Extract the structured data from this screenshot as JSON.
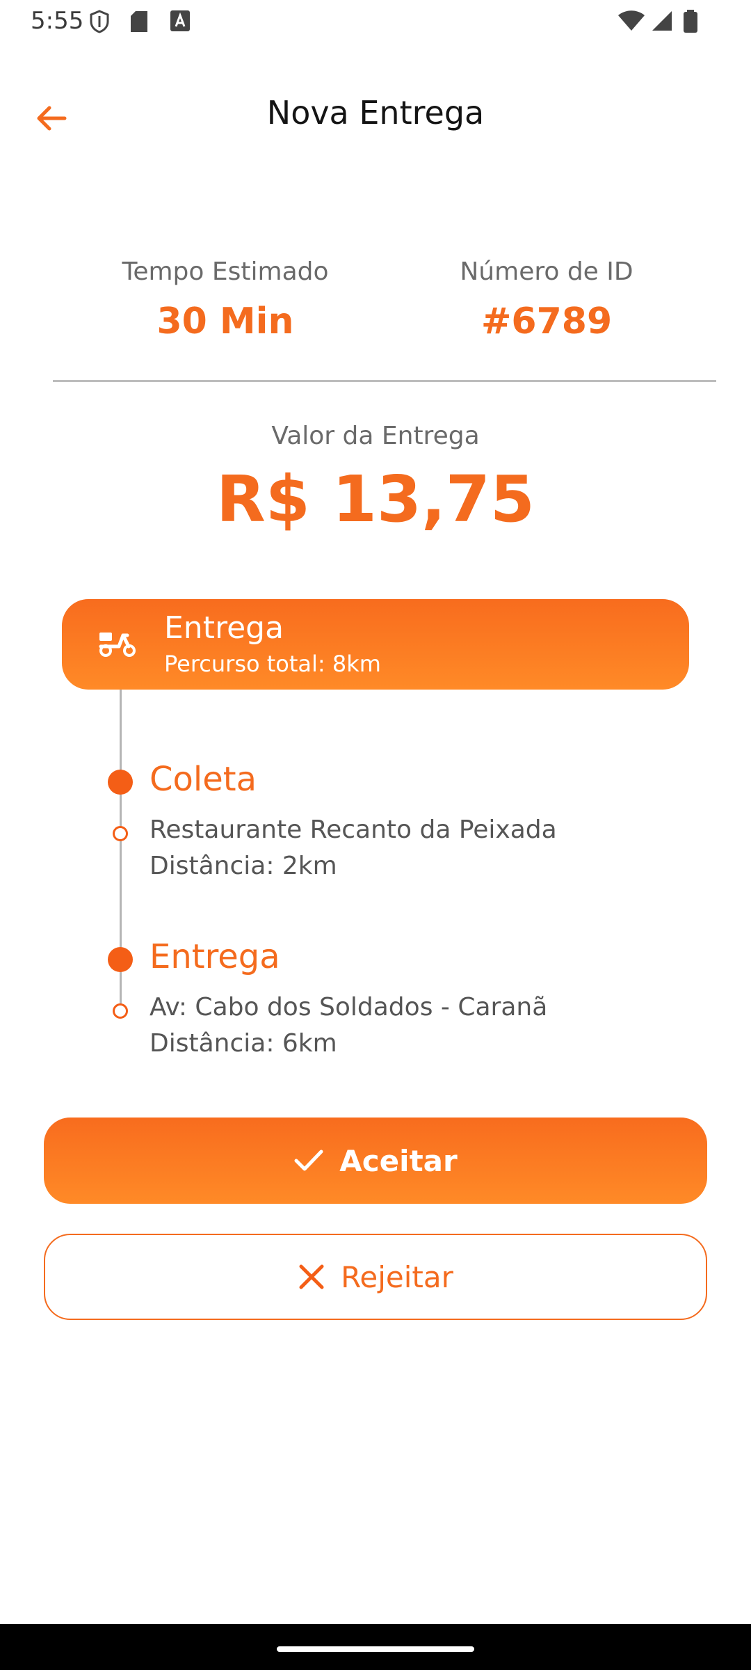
{
  "status_bar": {
    "time": "5:55",
    "left_icons": [
      "shield-icon",
      "sd-card-icon",
      "text-a-icon"
    ],
    "right_icons": [
      "wifi-icon",
      "signal-icon",
      "battery-icon"
    ]
  },
  "header": {
    "title": "Nova Entrega",
    "back_icon": "arrow-left-icon"
  },
  "stats": {
    "time_label": "Tempo Estimado",
    "time_value": "30 Min",
    "id_label": "Número de ID",
    "id_value": "#6789"
  },
  "delivery_value": {
    "label": "Valor da Entrega",
    "amount": "R$ 13,75"
  },
  "route": {
    "icon": "scooter-icon",
    "title": "Entrega",
    "subtitle": "Percurso total: 8km"
  },
  "steps": [
    {
      "title": "Coleta",
      "place": "Restaurante Recanto da Peixada",
      "distance": "Distância: 2km"
    },
    {
      "title": "Entrega",
      "place": "Av: Cabo dos Soldados - Caranã",
      "distance": "Distância: 6km"
    }
  ],
  "actions": {
    "accept_label": "Aceitar",
    "accept_icon": "check-icon",
    "reject_label": "Rejeitar",
    "reject_icon": "close-icon"
  },
  "colors": {
    "accent": "#f46b1e",
    "accent_light": "#ff8a27",
    "text_muted": "#6a6a6a"
  }
}
